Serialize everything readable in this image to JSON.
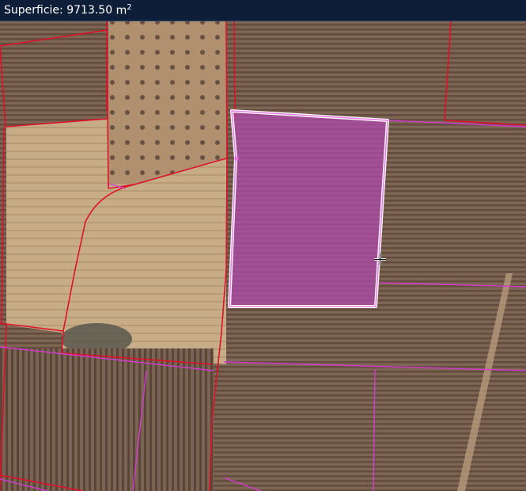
{
  "header": {
    "label": "Superficie:",
    "value": "9713.50",
    "unit": "m",
    "unit_exponent": "2"
  },
  "map": {
    "parcel_line_color": "#e0102a",
    "subparcel_line_color": "#d53ad0",
    "selection_fill": "#b24ab0",
    "selection_outline": "#ffffff",
    "cursor": "move-crosshair-icon"
  }
}
